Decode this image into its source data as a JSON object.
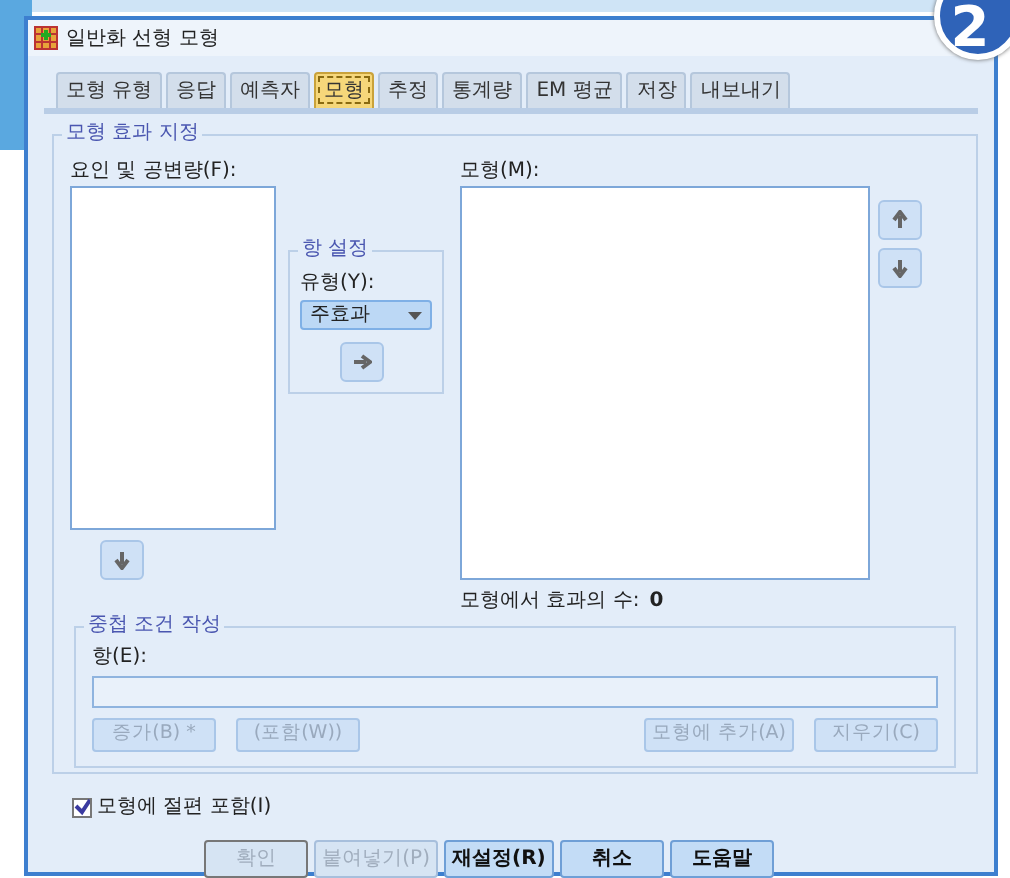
{
  "window": {
    "title": "일반화 선형 모형"
  },
  "step_badge": "2",
  "tabs": [
    {
      "label": "모형 유형",
      "selected": false
    },
    {
      "label": "응답",
      "selected": false
    },
    {
      "label": "예측자",
      "selected": false
    },
    {
      "label": "모형",
      "selected": true
    },
    {
      "label": "추정",
      "selected": false
    },
    {
      "label": "통계량",
      "selected": false
    },
    {
      "label": "EM 평균",
      "selected": false
    },
    {
      "label": "저장",
      "selected": false
    },
    {
      "label": "내보내기",
      "selected": false
    }
  ],
  "effects": {
    "title": "모형 효과 지정",
    "factors_label": "요인 및 공변량(F):",
    "model_label": "모형(M):",
    "count_label": "모형에서 효과의 수:",
    "count": "0"
  },
  "term_settings": {
    "title": "항 설정",
    "type_label": "유형(Y):",
    "type_value": "주효과"
  },
  "nested": {
    "title": "중첩 조건 작성",
    "term_label": "항(E):",
    "left_buttons": [
      {
        "label": "증가(B) *",
        "disabled": true
      },
      {
        "label": "(포함(W))",
        "disabled": true
      }
    ],
    "right_buttons": [
      {
        "label": "모형에 추가(A)",
        "disabled": true
      },
      {
        "label": "지우기(C)",
        "disabled": true
      }
    ]
  },
  "intercept": {
    "label": "모형에 절편 포함(I)",
    "checked": true
  },
  "buttons": [
    {
      "label": "확인",
      "disabled": true
    },
    {
      "label": "붙여넣기(P)",
      "disabled": true
    },
    {
      "label": "재설정(R)",
      "disabled": false
    },
    {
      "label": "취소",
      "disabled": false
    },
    {
      "label": "도움말",
      "disabled": false
    }
  ]
}
